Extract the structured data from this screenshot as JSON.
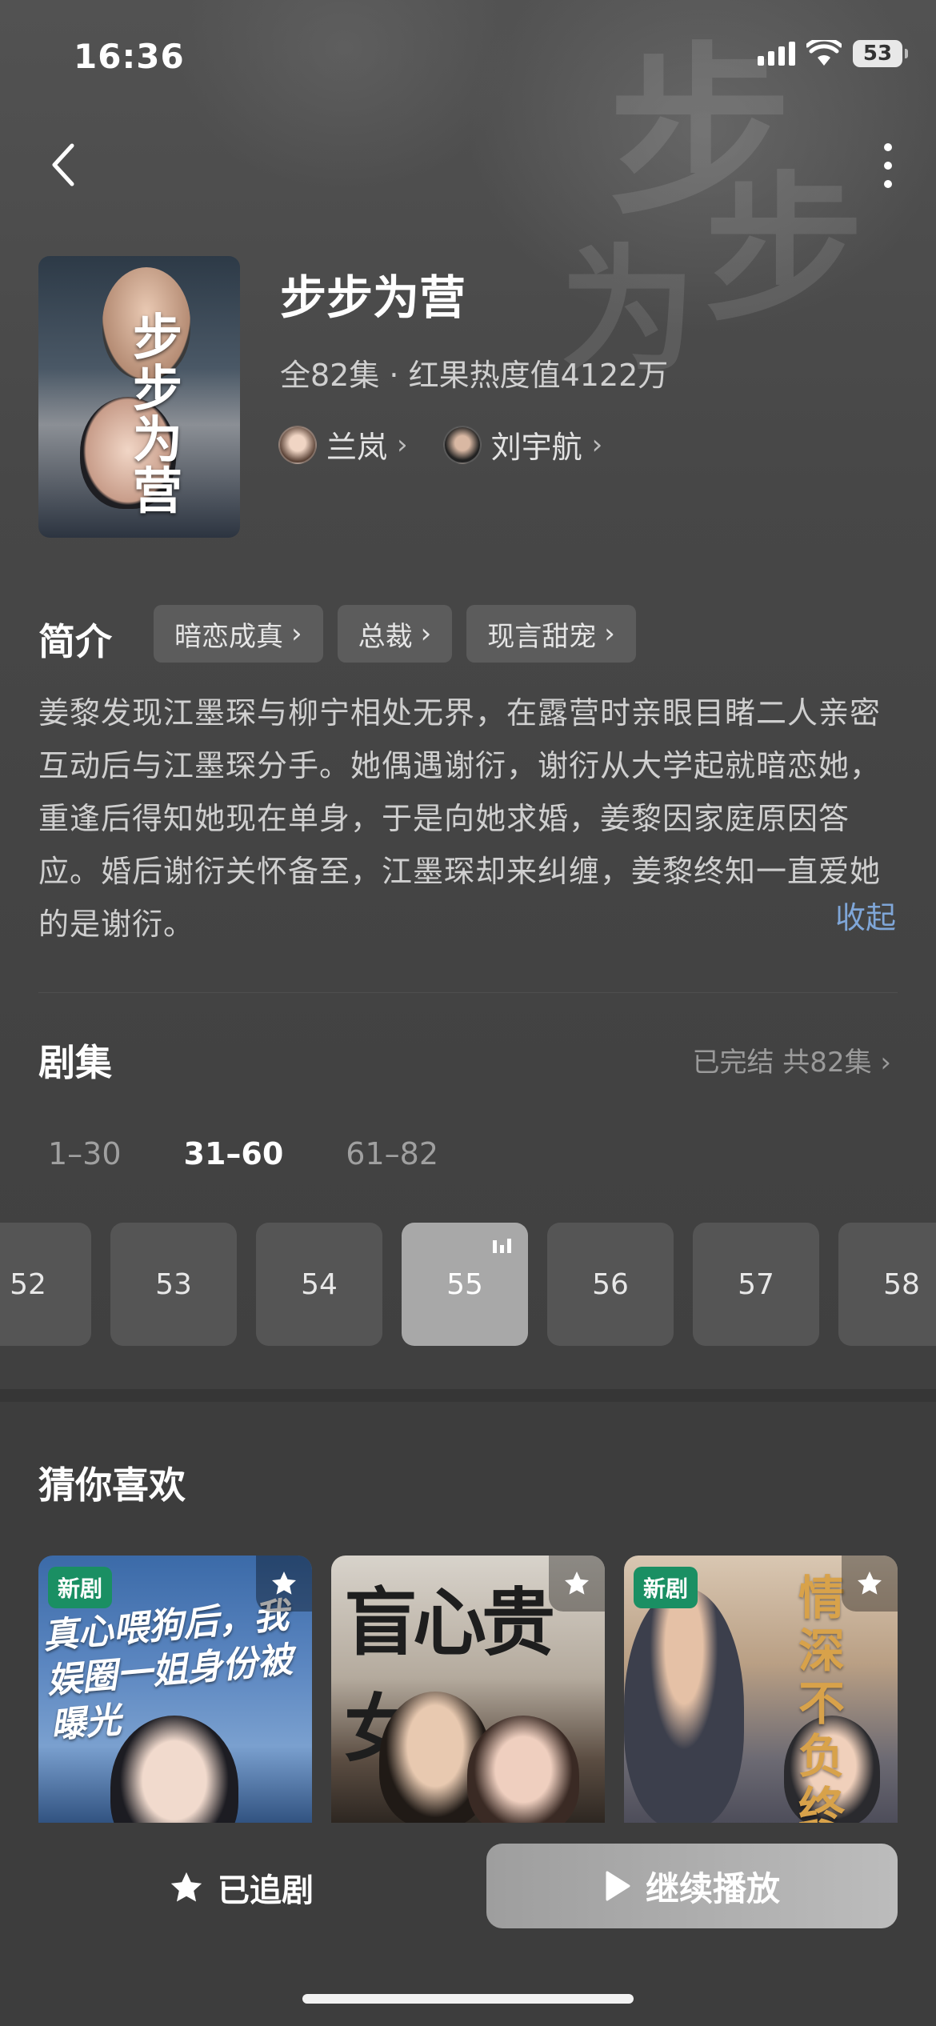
{
  "status_bar": {
    "time": "16:36",
    "battery": "53"
  },
  "drama": {
    "title": "步步为营",
    "meta": "全82集 · 红果热度值4122万",
    "poster_title": "步步为营",
    "cast": [
      {
        "name": "兰岚"
      },
      {
        "name": "刘宇航"
      }
    ]
  },
  "intro": {
    "label": "简介",
    "tags": [
      "暗恋成真",
      "总裁",
      "现言甜宠"
    ],
    "synopsis": "姜黎发现江墨琛与柳宁相处无界，在露营时亲眼目睹二人亲密互动后与江墨琛分手。她偶遇谢衍，谢衍从大学起就暗恋她，重逢后得知她现在单身，于是向她求婚，姜黎因家庭原因答应。婚后谢衍关怀备至，江墨琛却来纠缠，姜黎终知一直爱她的是谢衍。",
    "collapse_label": "收起"
  },
  "episodes": {
    "label": "剧集",
    "status": "已完结 共82集",
    "ranges": [
      "1–30",
      "31–60",
      "61–82"
    ],
    "active_range": 1,
    "items": [
      "52",
      "53",
      "54",
      "55",
      "56",
      "57",
      "58"
    ],
    "current": "55"
  },
  "recommend": {
    "label": "猜你喜欢",
    "new_badge": "新剧",
    "cards": [
      {
        "poster_text": "真心喂狗后，我娱圈一姐身份被曝光",
        "is_new": true
      },
      {
        "poster_text": "盲心贵女",
        "is_new": false
      },
      {
        "poster_text": "情深不负终有",
        "is_new": true
      }
    ]
  },
  "actions": {
    "follow_label": "已追剧",
    "play_label": "继续播放"
  },
  "colors": {
    "accent_link": "#7fa6d8",
    "new_badge": "#1a8f63",
    "background": "#3d3d3d"
  }
}
